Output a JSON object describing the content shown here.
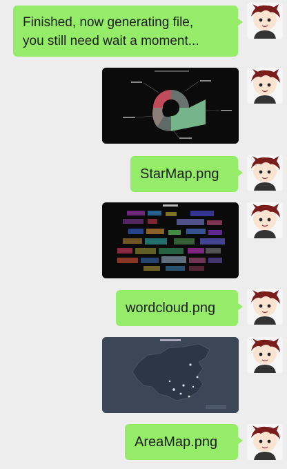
{
  "messages": [
    {
      "type": "text",
      "lines": [
        "Finished, now generating file,",
        "you still need wait a moment..."
      ]
    },
    {
      "type": "image",
      "image_name": "star-map-chart-thumbnail"
    },
    {
      "type": "text",
      "text": "StarMap.png"
    },
    {
      "type": "image",
      "image_name": "word-cloud-thumbnail"
    },
    {
      "type": "text",
      "text": "wordcloud.png"
    },
    {
      "type": "image",
      "image_name": "area-map-thumbnail"
    },
    {
      "type": "text",
      "text": "AreaMap.png"
    }
  ],
  "avatar": {
    "icon": "cartoon-boy-avatar",
    "hair_color": "#7a1c1c"
  },
  "colors": {
    "bubble": "#95ec69",
    "background": "#ededed",
    "map_bg": "#3b4656"
  }
}
